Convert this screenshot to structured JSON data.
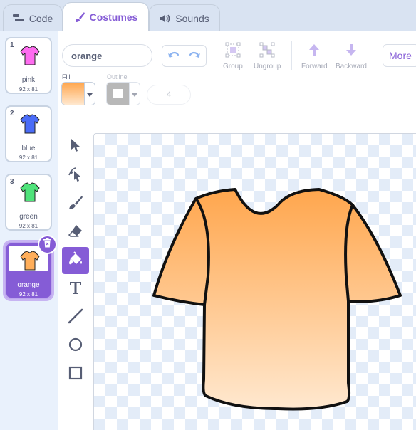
{
  "tabs": [
    {
      "label": "Code",
      "icon": "code-icon"
    },
    {
      "label": "Costumes",
      "icon": "brush-icon",
      "active": true
    },
    {
      "label": "Sounds",
      "icon": "speaker-icon"
    }
  ],
  "costumes": [
    {
      "number": "1",
      "name": "pink",
      "size": "92 x 81",
      "color": "#ff6cf0"
    },
    {
      "number": "2",
      "name": "blue",
      "size": "92 x 81",
      "color": "#4a6cf7"
    },
    {
      "number": "3",
      "name": "green",
      "size": "92 x 81",
      "color": "#4fe37a"
    },
    {
      "number": "4",
      "name": "orange",
      "size": "92 x 81",
      "color": "#ffae5a",
      "selected": true
    }
  ],
  "editor": {
    "costume_name": "orange",
    "toolbar": {
      "group": "Group",
      "ungroup": "Ungroup",
      "forward": "Forward",
      "backward": "Backward",
      "more": "More"
    },
    "fill_label": "Fill",
    "outline_label": "Outline",
    "outline_width": "4",
    "fill_color_top": "#ffa64d",
    "fill_color_bottom": "#ffe8cf",
    "accent": "#855cd6"
  },
  "tools": [
    "select-icon",
    "reshape-icon",
    "brush-icon",
    "eraser-icon",
    "fill-icon",
    "text-icon",
    "line-icon",
    "circle-icon",
    "rectangle-icon"
  ]
}
